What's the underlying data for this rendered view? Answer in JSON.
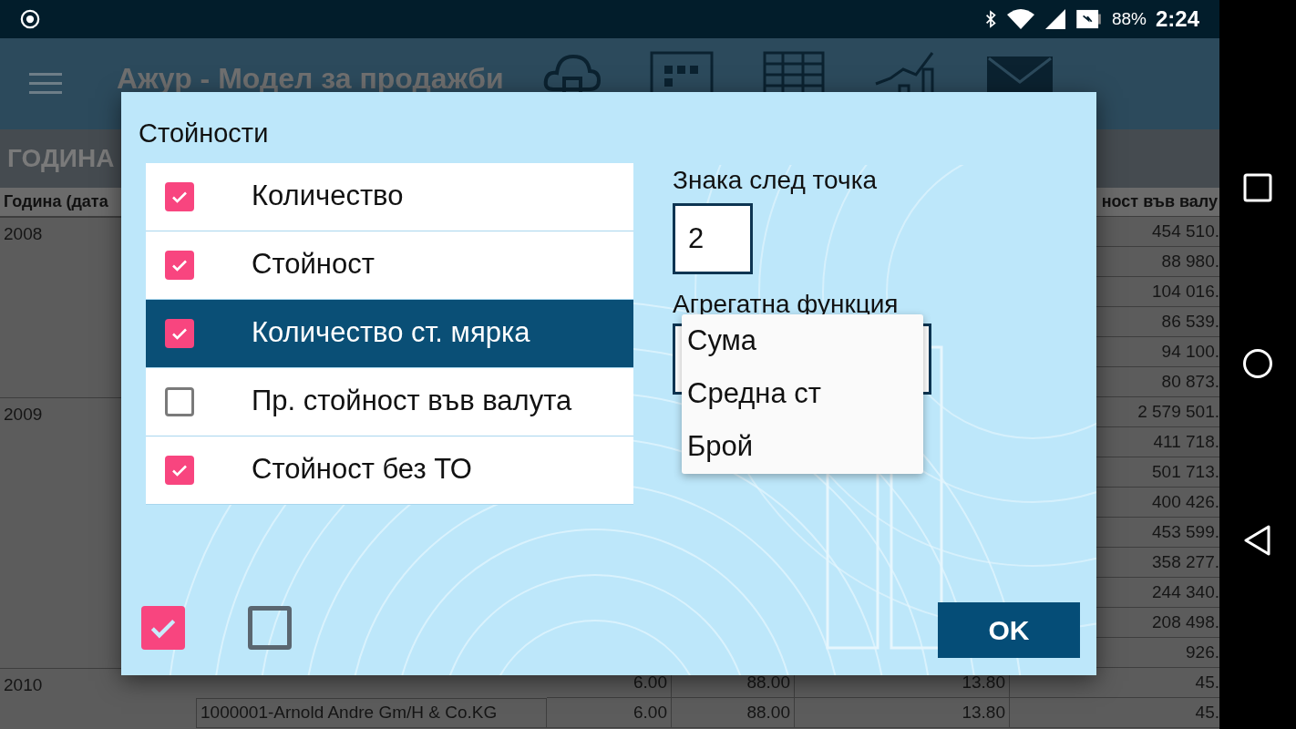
{
  "status_bar": {
    "battery": "88%",
    "time": "2:24"
  },
  "app_bar": {
    "title": "Ажур - Модел за продажби"
  },
  "section_header": "ГОДИНА",
  "table": {
    "columns": [
      "Година (дата",
      "ност във валу"
    ],
    "rows": [
      {
        "year": "2008",
        "value": "454 510."
      },
      {
        "value": "88 980."
      },
      {
        "value": "104 016."
      },
      {
        "value": "86 539."
      },
      {
        "value": "94 100."
      },
      {
        "value": "80 873."
      },
      {
        "year": "2009",
        "value": "2 579 501."
      },
      {
        "value": "411 718."
      },
      {
        "value": "501 713."
      },
      {
        "value": "400 426."
      },
      {
        "value": "453 599."
      },
      {
        "value": "358 277."
      },
      {
        "value": "244 340."
      },
      {
        "value": "208 498."
      },
      {
        "value": "926."
      },
      {
        "year": "2010",
        "qty": "6.00",
        "price": "88.00",
        "tax": "13.80",
        "value": "45."
      },
      {
        "name": "1000001-Arnold Andre Gm/H & Co.KG",
        "qty": "6.00",
        "price": "88.00",
        "tax": "13.80",
        "value": "45."
      }
    ]
  },
  "dialog": {
    "title": "Стойности",
    "items": [
      {
        "label": "Количество",
        "checked": true,
        "selected": false
      },
      {
        "label": "Стойност",
        "checked": true,
        "selected": false
      },
      {
        "label": "Количество ст. мярка",
        "checked": true,
        "selected": true
      },
      {
        "label": "Пр. стойност във валута",
        "checked": false,
        "selected": false
      },
      {
        "label": "Стойност без ТО",
        "checked": true,
        "selected": false
      }
    ],
    "decimals": {
      "label": "Знака след точка",
      "value": "2"
    },
    "aggregate": {
      "label": "Агрегатна функция",
      "options": [
        "Сума",
        "Средна ст",
        "Брой"
      ]
    },
    "bulk_toggles": [
      {
        "checked": true
      },
      {
        "checked": false
      }
    ],
    "ok": "OK"
  }
}
